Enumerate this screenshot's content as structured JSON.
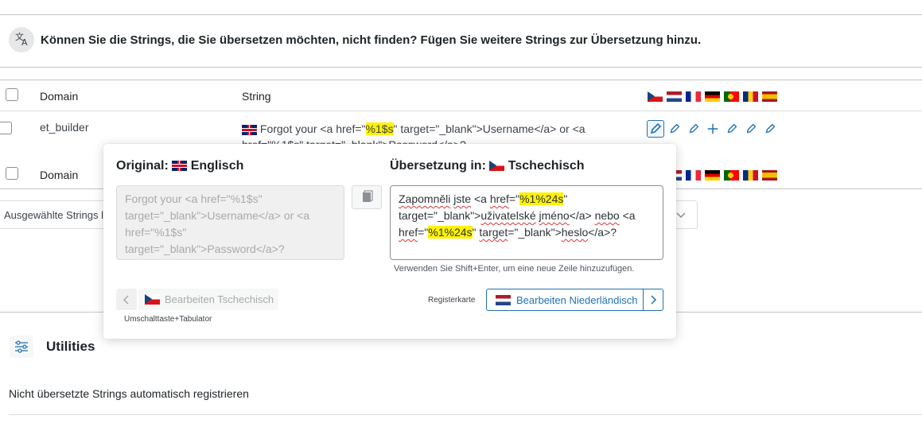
{
  "notice": {
    "icon": "translate-icon",
    "text": "Können Sie die Strings, die Sie übersetzen möchten, nicht finden? Fügen Sie weitere Strings zur Übersetzung hinzu."
  },
  "table": {
    "header": {
      "domain": "Domain",
      "string": "String"
    },
    "flags": [
      "cz",
      "nl",
      "fr",
      "de",
      "pt",
      "ro",
      "es"
    ],
    "rows": [
      {
        "domain": "et_builder",
        "flag": "gb",
        "string_line1": "Forgot your <a href=\"",
        "string_hl": "%1$s",
        "string_line1b": "\" target=\"_blank\">Username</a> or <a",
        "string_line2": "href=\"%1$s\" target=\"_blank\">Password</a>?"
      }
    ],
    "footer": {
      "domain": "Domain"
    },
    "bulk_label": "Ausgewählte Strings lö"
  },
  "popup": {
    "original_label": "Original:",
    "original_lang": "Englisch",
    "original_text": "Forgot your <a href=\"%1$s\"\ntarget=\"_blank\">Username</a> or <a\nhref=\"%1$s\"\ntarget=\"_blank\">Password</a>?",
    "translation_label": "Übersetzung in:",
    "translation_lang": "Tschechisch",
    "translation": {
      "w1": "Zapomněli",
      "w2": "jste",
      "t1": " <a ",
      "w3": "href",
      "t2": "=\"",
      "h1": "%1%24s",
      "t3": "\"",
      "t4": "target=\"_blank\">",
      "w4": "uživatelské",
      "w5": "jméno",
      "t5": "</a> ",
      "w6": "nebo",
      "t6": " <a",
      "w7": "href",
      "t7": "=\"",
      "h2": "%1%24s",
      "t8": "\" ",
      "w8": "target",
      "t9": "=\"_blank\">",
      "w9": "heslo",
      "t10": "</a>?"
    },
    "hint": "Verwenden Sie Shift+Enter, um eine neue Zeile hinzuzufügen.",
    "prev_button": "Bearbeiten Tschechisch",
    "prev_shortcut": "Umschalttaste+Tabulator",
    "next_shortcut": "Registerkarte",
    "next_button": "Bearbeiten Niederländisch"
  },
  "utilities": {
    "title": "Utilities",
    "item": "Nicht übersetzte Strings automatisch registrieren"
  },
  "colors": {
    "accent": "#2271b1",
    "highlight": "#fff200",
    "border": "#c3c4c7"
  }
}
